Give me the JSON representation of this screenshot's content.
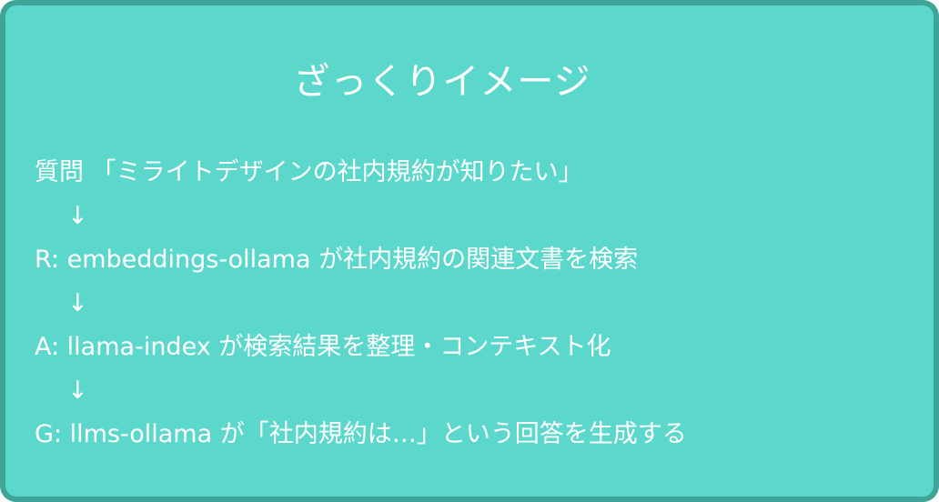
{
  "title": "ざっくりイメージ",
  "steps": {
    "question": "質問 「ミライトデザインの社内規約が知りたい」",
    "arrow1": "↓",
    "retrieve": "R: embeddings-ollama が社内規約の関連文書を検索",
    "arrow2": "↓",
    "augment": "A: llama-index が検索結果を整理・コンテキスト化",
    "arrow3": "↓",
    "generate": "G: llms-ollama が「社内規約は…」という回答を生成する"
  }
}
